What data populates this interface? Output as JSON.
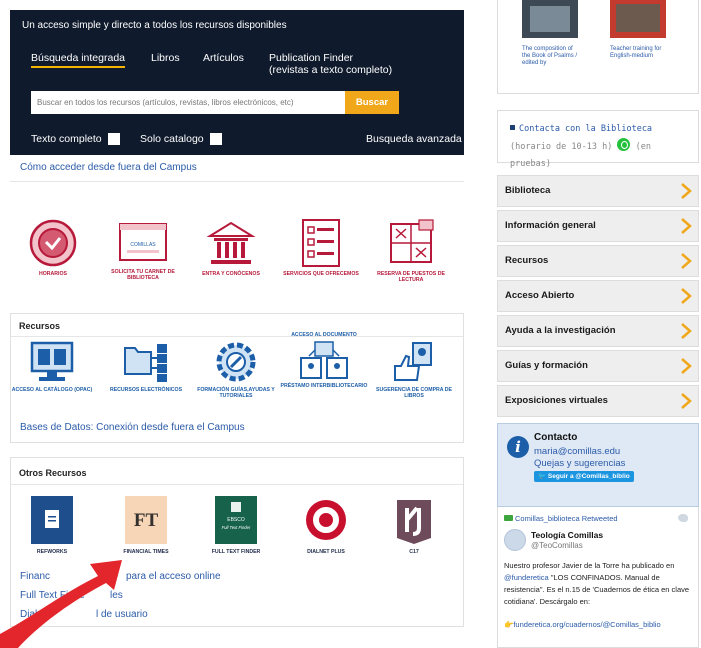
{
  "search": {
    "tagline": "Un acceso simple y directo a todos los recursos disponibles",
    "tabs": [
      "Búsqueda integrada",
      "Libros",
      "Artículos",
      "Publication Finder",
      "(revistas a texto completo)"
    ],
    "placeholder": "Buscar en todos los recursos (artículos, revistas, libros electrónicos, etc)",
    "button": "Buscar",
    "full_text": "Texto completo",
    "catalog_only": "Solo catalogo",
    "advanced": "Busqueda avanzada"
  },
  "campus_link": "Cómo acceder desde fuera del Campus",
  "services": {
    "tiles": [
      {
        "label": "HORARIOS"
      },
      {
        "label": "SOLICITA TU CARNET DE BIBLIOTECA",
        "card_text": "COMILLAS"
      },
      {
        "label": "ENTRA Y CONÓCENOS"
      },
      {
        "label": "SERVICIOS QUE OFRECEMOS"
      },
      {
        "label": "RESERVA DE PUESTOS DE LECTURA"
      }
    ]
  },
  "recursos": {
    "title": "Recursos",
    "tiles": [
      {
        "label": "ACCESO AL CATÁLOGO (OPAC)"
      },
      {
        "label": "RECURSOS ELECTRÓNICOS"
      },
      {
        "label": "FORMACIÓN GUÍAS,AYUDAS Y TUTORIALES"
      },
      {
        "label": "ACCESO AL DOCUMENTO",
        "sub": "PRÉSTAMO INTERBIBLIOTECARIO"
      },
      {
        "label": "SUGERENCIA DE COMPRA DE LIBROS"
      }
    ],
    "link": "Bases de Datos: Conexión desde fuera el Campus"
  },
  "otros": {
    "title": "Otros Recursos",
    "tiles": [
      {
        "label": "REFWORKS"
      },
      {
        "label": "FINANCIAL TIMES",
        "logo": "FT"
      },
      {
        "label": "FULL TEXT FINDER",
        "logo": "EBSCO",
        "logo_sub": "Full Text Finder"
      },
      {
        "label": "DIALNET PLUS"
      },
      {
        "label": "C17"
      }
    ],
    "links": [
      "Financ",
      "para el acceso online",
      "Full Text Finde",
      "les",
      "Diale",
      "l de usuario"
    ]
  },
  "books": [
    {
      "title": "The composition of the Book of Psalms / edited by"
    },
    {
      "title": "Teacher training for English-medium"
    }
  ],
  "contact_box": {
    "link": "Contacta con la Biblioteca",
    "hours": "(horario de 10-13 h)",
    "note": "(en pruebas)"
  },
  "menu": [
    "Biblioteca",
    "Información general",
    "Recursos",
    "Acceso Abierto",
    "Ayuda a la investigación",
    "Guías y formación",
    "Exposiciones virtuales"
  ],
  "contact_card": {
    "title": "Contacto",
    "email": "maria@comillas.edu",
    "suggest": "Quejas y sugerencias",
    "follow": "Seguir a @Comillas_biblio"
  },
  "tweet": {
    "retweet": "Comillas_biblioteca Retweeted",
    "name": "Teología Comillas",
    "handle": "@TeoComillas",
    "text_1": "Nuestro profesor Javier de la Torre ha publicado en",
    "mention": "@funderetica",
    "text_2": " \"LOS CONFINADOS. Manual de resistencia\". Es el n.15 de 'Cuadernos de ética en clave cotidiana'. Descárgalo en:",
    "link": "funderetica.org/cuadernos/@Comillas_biblio"
  },
  "colors": {
    "navy": "#0f1a2c",
    "accent": "#f0a81a",
    "brand_red": "#b7193a",
    "brand_blue": "#1d5ea8",
    "arrow": "#e3262b"
  }
}
